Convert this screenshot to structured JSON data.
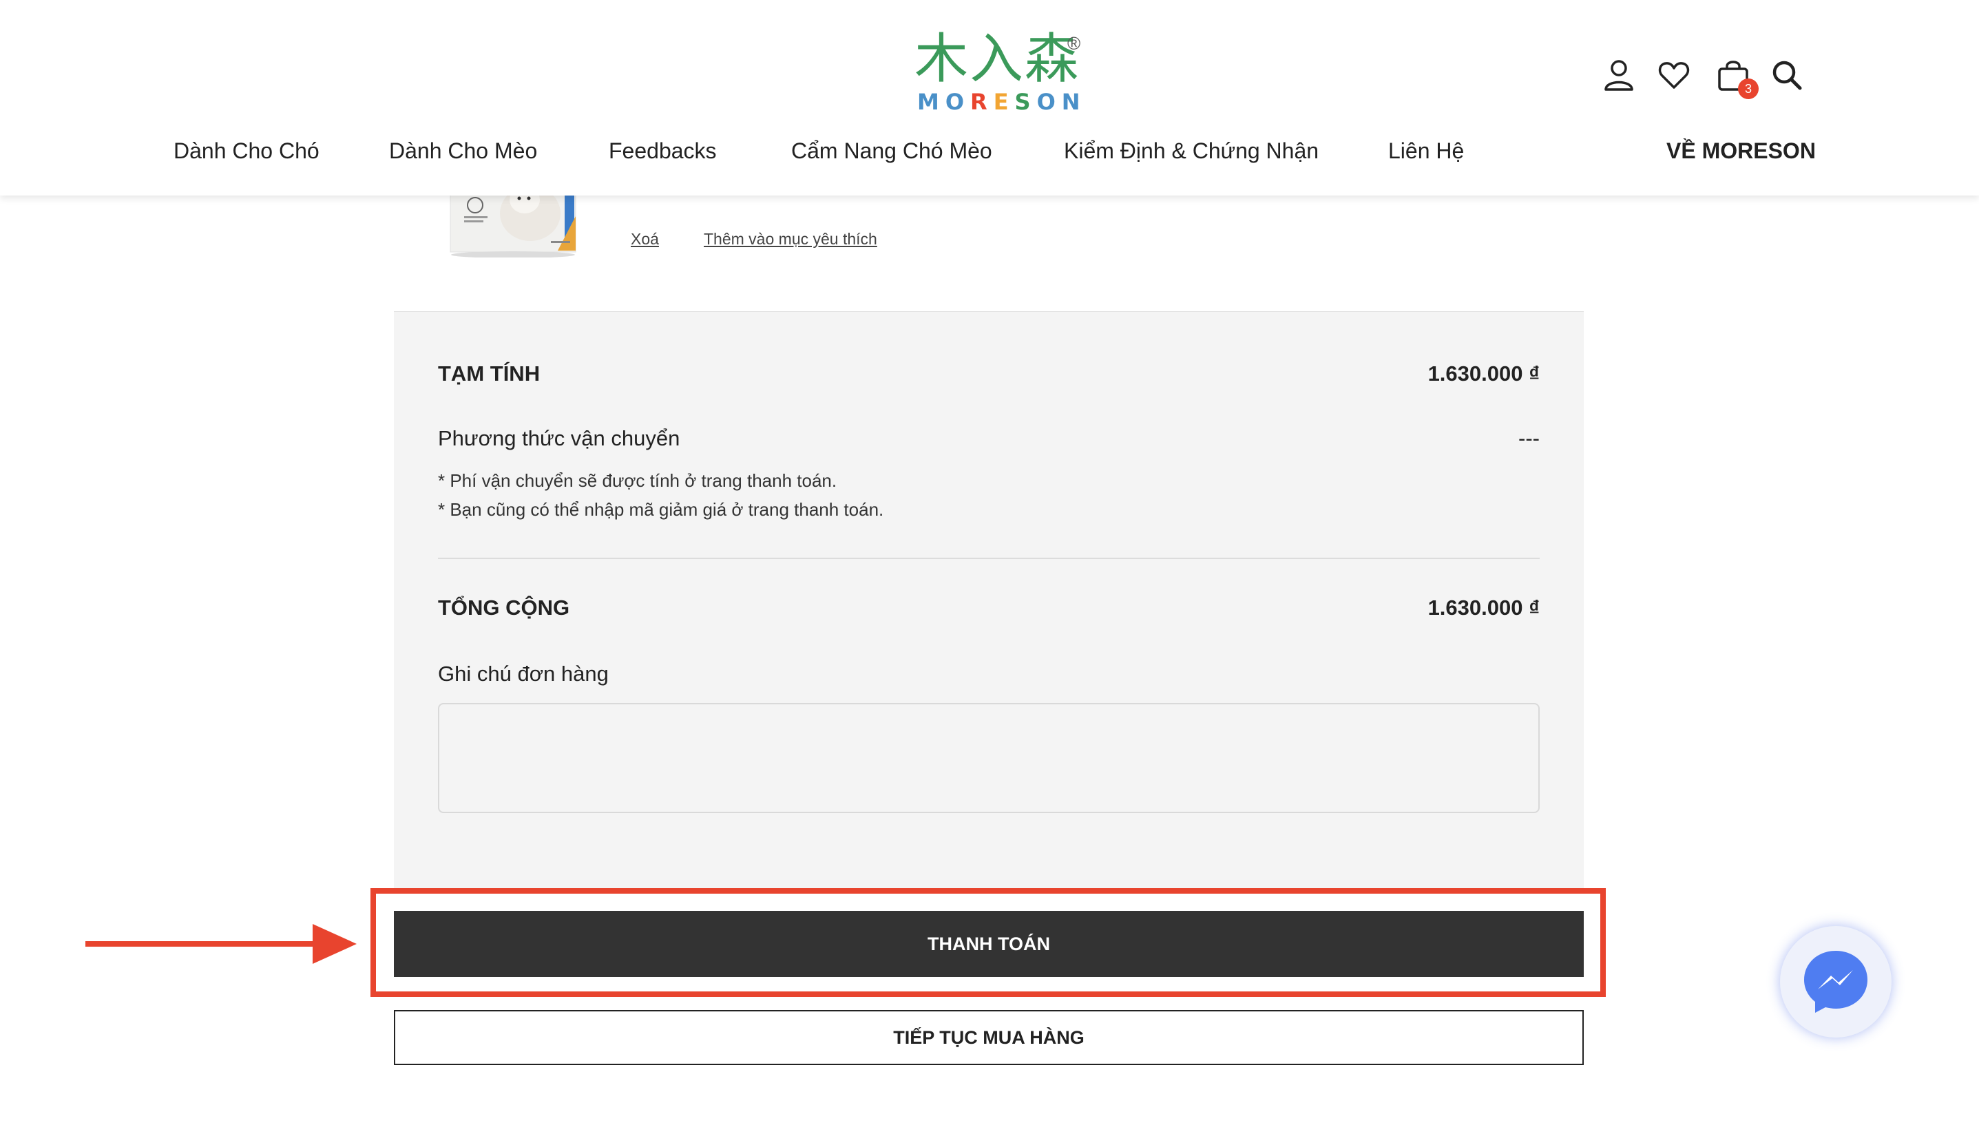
{
  "header": {
    "logo_cn": "木入森",
    "logo_reg": "®",
    "logo_en_letters": [
      "M",
      "O",
      "R",
      "E",
      "S",
      "O",
      "N"
    ],
    "logo_en_colors": [
      "#4a90c8",
      "#4a90c8",
      "#e8442e",
      "#f2a533",
      "#3b9a5a",
      "#4a90c8",
      "#4a90c8"
    ],
    "icons": [
      "user-icon",
      "heart-icon",
      "cart-icon",
      "search-icon"
    ],
    "cart_count": "3"
  },
  "nav": {
    "items": [
      {
        "label": "Dành Cho Chó"
      },
      {
        "label": "Dành Cho Mèo"
      },
      {
        "label": "Feedbacks"
      },
      {
        "label": "Cẩm Nang Chó Mèo"
      },
      {
        "label": "Kiểm Định & Chứng Nhận"
      },
      {
        "label": "Liên Hệ"
      }
    ],
    "about": "VỀ MORESON"
  },
  "product": {
    "remove_label": "Xoá",
    "wishlist_label": "Thêm vào mục yêu thích"
  },
  "summary": {
    "subtotal_label": "TẠM TÍNH",
    "subtotal_value": "1.630.000 ₫",
    "shipping_label": "Phương thức vận chuyển",
    "shipping_value": "---",
    "note1": "* Phí vận chuyển sẽ được tính ở trang thanh toán.",
    "note2": "* Bạn cũng có thể nhập mã giảm giá ở trang thanh toán.",
    "total_label": "TỔNG CỘNG",
    "total_value": "1.630.000 ₫",
    "order_note_label": "Ghi chú đơn hàng",
    "order_note_value": ""
  },
  "buttons": {
    "checkout": "THANH TOÁN",
    "continue": "TIẾP TỤC MUA HÀNG"
  },
  "colors": {
    "annotation": "#e8442e",
    "checkout_bg": "#333333",
    "messenger": "#4f7df1"
  }
}
